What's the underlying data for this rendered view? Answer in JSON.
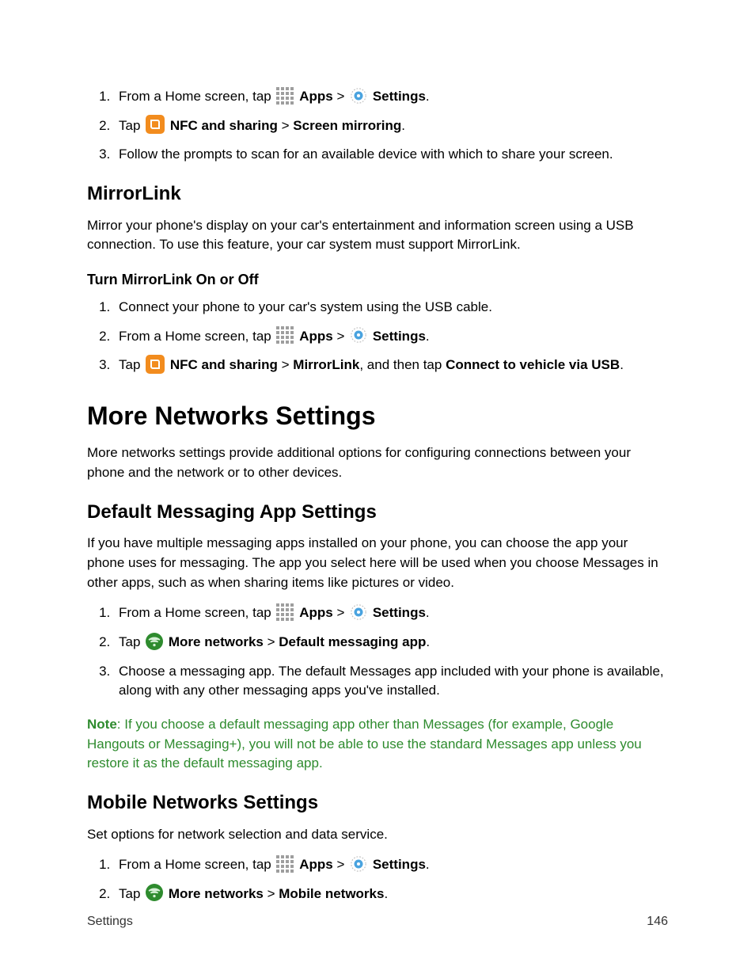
{
  "icons": {
    "apps_name": "apps-grid-icon",
    "gear_name": "settings-gear-icon",
    "nfc_name": "nfc-square-icon",
    "morenet_name": "more-networks-icon"
  },
  "steps_top": [
    {
      "prefix": "From a Home screen, tap",
      "apps_label": "Apps",
      "sep": " > ",
      "settings_label": "Settings",
      "suffix": "."
    },
    {
      "prefix": "Tap",
      "nfc_label": "NFC and sharing",
      "sep": " > ",
      "screen_label": "Screen mirroring",
      "suffix": "."
    },
    {
      "text": "Follow the prompts to scan for an available device with which to share your screen."
    }
  ],
  "mirrorlink": {
    "heading": "MirrorLink",
    "para": "Mirror your phone's display on your car's entertainment and information screen using a USB connection. To use this feature, your car system must support MirrorLink.",
    "sub": "Turn MirrorLink On or Off",
    "steps": [
      {
        "text": "Connect your phone to your car's system using the USB cable."
      },
      {
        "prefix": "From a Home screen, tap",
        "apps_label": "Apps",
        "sep": " > ",
        "settings_label": "Settings",
        "suffix": "."
      },
      {
        "prefix": "Tap",
        "nfc_label": "NFC and sharing",
        "sep": " > ",
        "mlink_label": "MirrorLink",
        "mid": ", and then tap ",
        "connect_label": "Connect to vehicle via USB",
        "suffix": "."
      }
    ]
  },
  "more_networks": {
    "heading": "More Networks Settings",
    "para": "More networks settings provide additional options for configuring connections between your phone and the network or to other devices."
  },
  "default_msg": {
    "heading": "Default Messaging App Settings",
    "para": "If you have multiple messaging apps installed on your phone, you can choose the app your phone uses for messaging. The app you select here will be used when you choose Messages in other apps, such as when sharing items like pictures or video.",
    "steps": [
      {
        "prefix": "From a Home screen, tap",
        "apps_label": "Apps",
        "sep": " > ",
        "settings_label": "Settings",
        "suffix": "."
      },
      {
        "prefix": "Tap",
        "morenet_label": "More networks",
        "sep": " > ",
        "dma_label": "Default messaging app",
        "suffix": "."
      },
      {
        "text": "Choose a messaging app. The default Messages app included with your phone is available, along with any other messaging apps you've installed."
      }
    ],
    "note_label": "Note",
    "note_text": ": If you choose a default messaging app other than Messages (for example, Google Hangouts or Messaging+), you will not be able to use the standard Messages app unless you restore it as the default messaging app."
  },
  "mobile_net": {
    "heading": "Mobile Networks Settings",
    "para": "Set options for network selection and data service.",
    "steps": [
      {
        "prefix": "From a Home screen, tap",
        "apps_label": "Apps",
        "sep": " > ",
        "settings_label": "Settings",
        "suffix": "."
      },
      {
        "prefix": "Tap",
        "morenet_label": "More networks",
        "sep": " > ",
        "mn_label": "Mobile networks",
        "suffix": "."
      }
    ]
  },
  "footer": {
    "left": "Settings",
    "right": "146"
  }
}
